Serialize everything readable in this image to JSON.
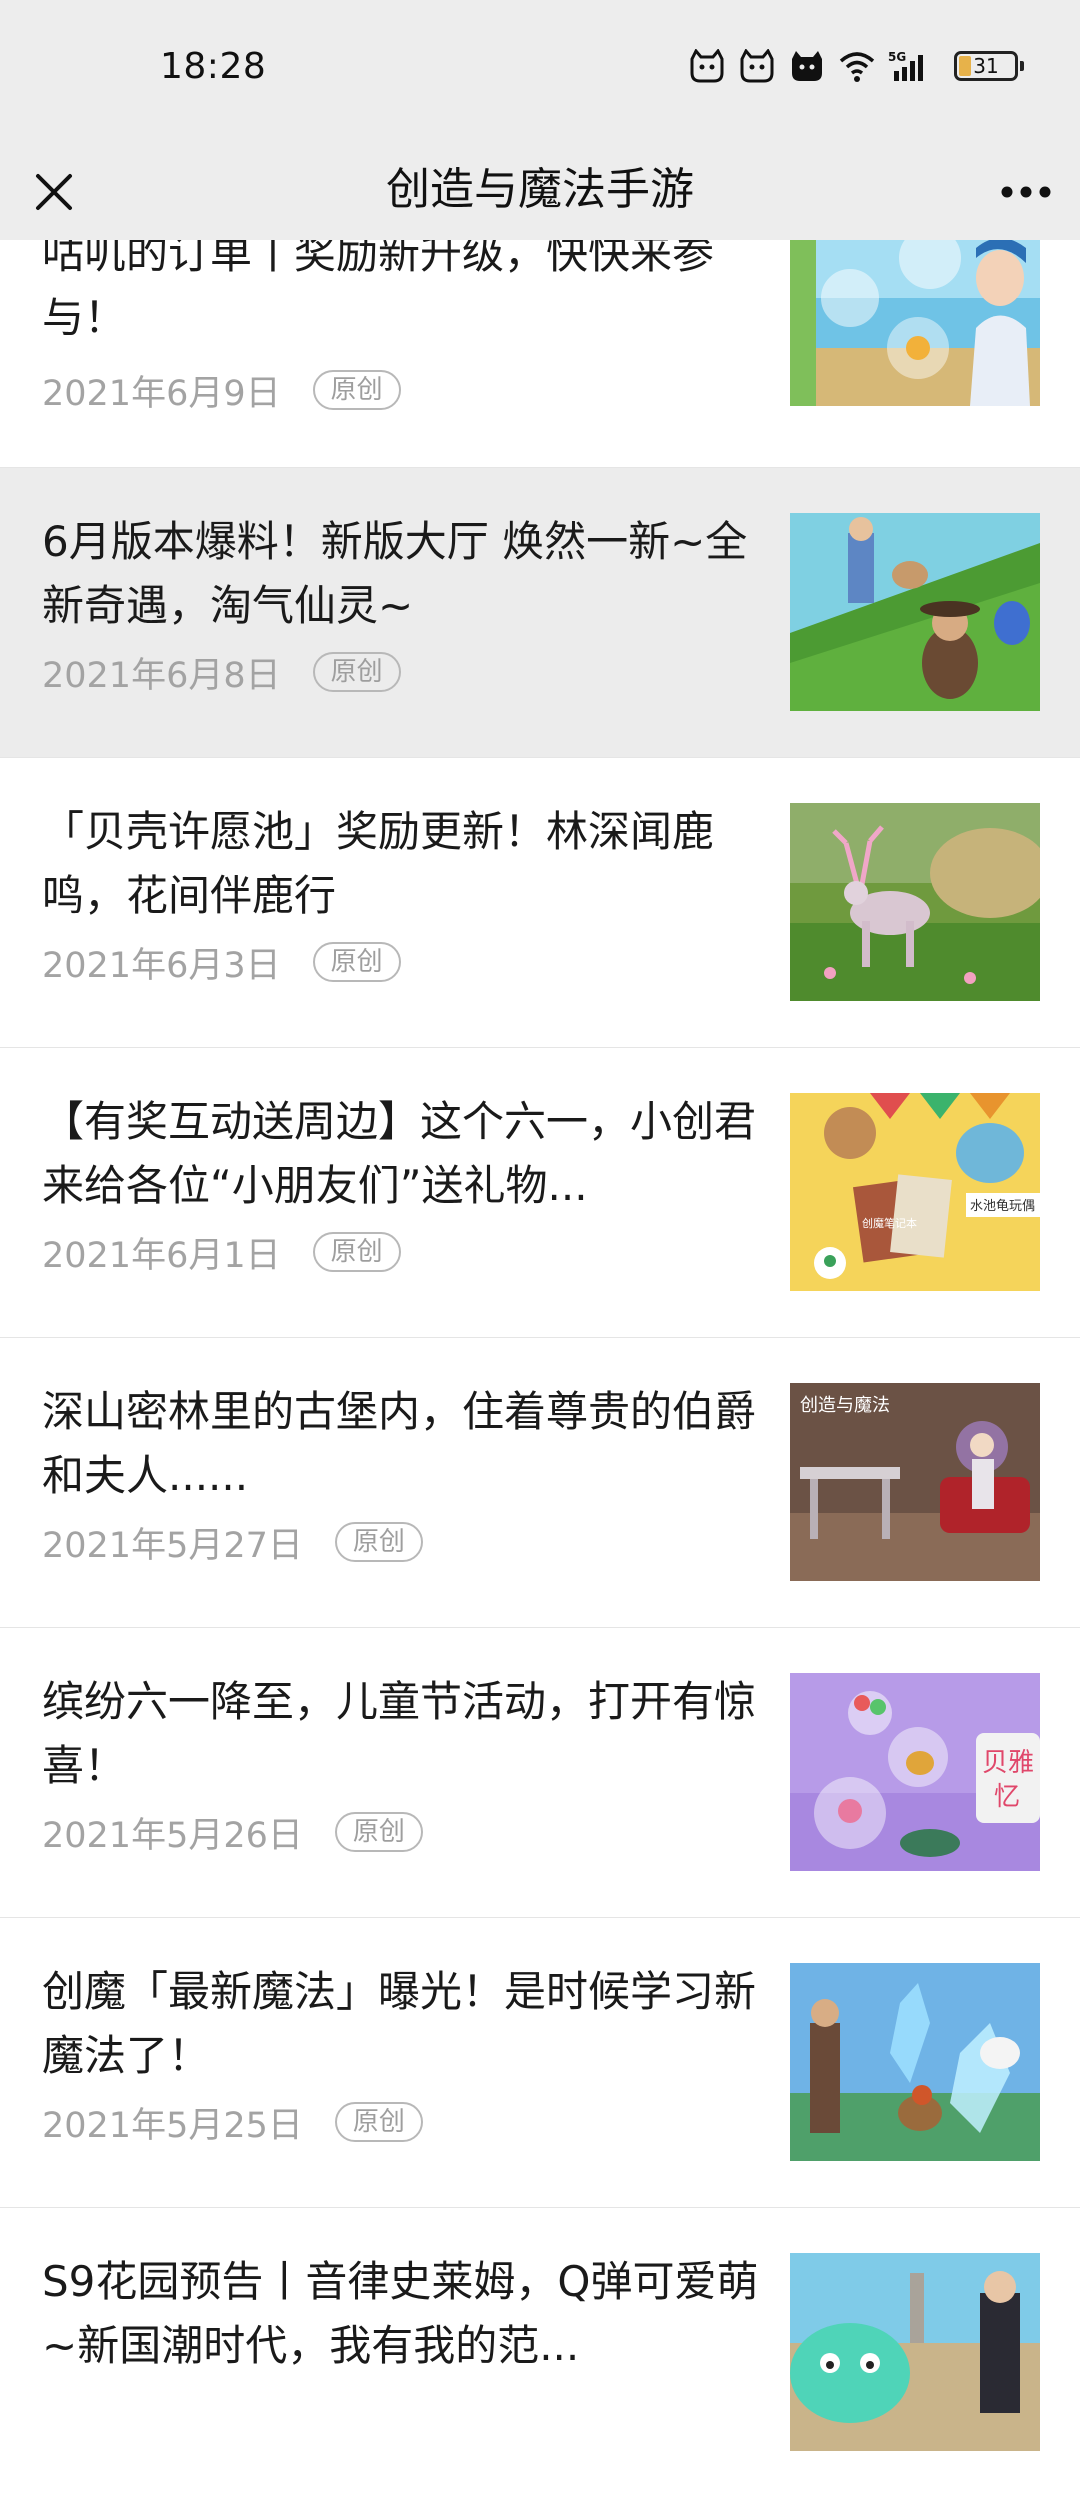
{
  "status_bar": {
    "time": "18:28",
    "battery": "31",
    "network": "5G",
    "icons": [
      "cat-notification-icon",
      "cat-notification-icon",
      "cat-notification-icon",
      "wifi-icon",
      "signal-icon",
      "battery-icon"
    ]
  },
  "nav": {
    "title": "创造与魔法手游",
    "close_icon": "close-icon",
    "more_icon": "more-icon"
  },
  "articles": [
    {
      "title": "咕叽的订单丨奖励新升级，快快来参与！",
      "date": "2021年6月9日",
      "badge": "原创",
      "thumb": "fairy-girl-bubbles-icon"
    },
    {
      "title": "6月版本爆料！新版大厅 焕然一新~全新奇遇，淘气仙灵~",
      "date": "2021年6月8日",
      "badge": "原创",
      "thumb": "lobby-deer-icon"
    },
    {
      "title": "「贝壳许愿池」奖励更新！林深闻鹿鸣，花间伴鹿行",
      "date": "2021年6月3日",
      "badge": "原创",
      "thumb": "flower-deer-icon"
    },
    {
      "title": "【有奖互动送周边】这个六一，小创君来给各位“小朋友们”送礼物...",
      "date": "2021年6月1日",
      "badge": "原创",
      "thumb": "notebook-gifts-icon",
      "thumb_texts": [
        "创魔笔记本",
        "水池龟玩偶"
      ]
    },
    {
      "title": "深山密林里的古堡内，住着尊贵的伯爵和夫人......",
      "date": "2021年5月27日",
      "badge": "原创",
      "thumb": "castle-room-icon",
      "thumb_texts": [
        "创造与魔法"
      ]
    },
    {
      "title": "缤纷六一降至，儿童节活动，打开有惊喜！",
      "date": "2021年5月26日",
      "badge": "原创",
      "thumb": "bubble-gifts-icon",
      "thumb_texts": [
        "贝雅",
        "忆"
      ]
    },
    {
      "title": "创魔「最新魔法」曝光！是时候学习新魔法了！",
      "date": "2021年5月25日",
      "badge": "原创",
      "thumb": "ice-magic-icon"
    },
    {
      "title": "S9花园预告丨音律史莱姆，Q弹可爱萌~新国潮时代，我有我的范...",
      "date": "",
      "badge": "",
      "thumb": "slime-garden-icon"
    }
  ],
  "colors": {
    "header_bg": "#ededed",
    "pressed_row": "#ececec",
    "date_gray": "#a3a3a3",
    "title_text": "#1a1a1a"
  }
}
